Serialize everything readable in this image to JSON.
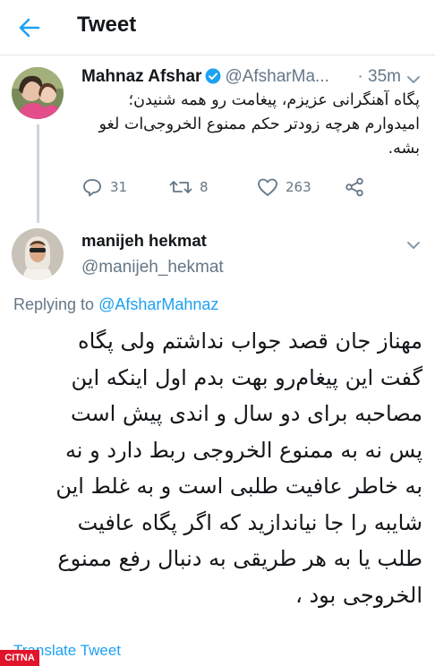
{
  "header": {
    "title": "Tweet"
  },
  "parent_tweet": {
    "name": "Mahnaz Afshar",
    "handle": "@AfsharMa...",
    "time": "· 35m",
    "text_lines": [
      "پگاه آهنگرانی عزیزم، پیغامت رو همه شنیدن؛",
      "امیدوارم هرچه زودتر حکم ممنوع الخروجی‌ات لغو",
      "بشه."
    ],
    "stats": {
      "replies": "31",
      "retweets": "8",
      "likes": "263"
    }
  },
  "reply_tweet": {
    "name": "manijeh hekmat",
    "handle": "@manijeh_hekmat",
    "replying_prefix": "Replying to",
    "replying_handle": "@AfsharMahnaz",
    "text_lines": [
      "مهناز جان قصد جواب نداشتم ولی پگاه",
      "گفت این پیغام‌رو بهت بدم اول اینکه این",
      "مصاحبه برای دو سال و اندی پیش است",
      "پس نه به ممنوع الخروجی ربط دارد و نه",
      "به خاطر عافیت طلبی است و به غلط این",
      "شایبه را جا نیاندازید که اگر پگاه عافیت",
      "طلب یا به هر طریقی به دنبال رفع ممنوع",
      "الخروجی بود ،"
    ],
    "translate_label": "Translate Tweet"
  },
  "watermark": "CITNA",
  "colors": {
    "accent": "#1da1f2",
    "secondary_text": "#657786",
    "divider": "#e1e8ed",
    "watermark": "#e0142a"
  },
  "icons": [
    "back-arrow-icon",
    "verified-badge-icon",
    "chevron-down-icon",
    "reply-icon",
    "retweet-icon",
    "like-icon",
    "share-icon"
  ]
}
